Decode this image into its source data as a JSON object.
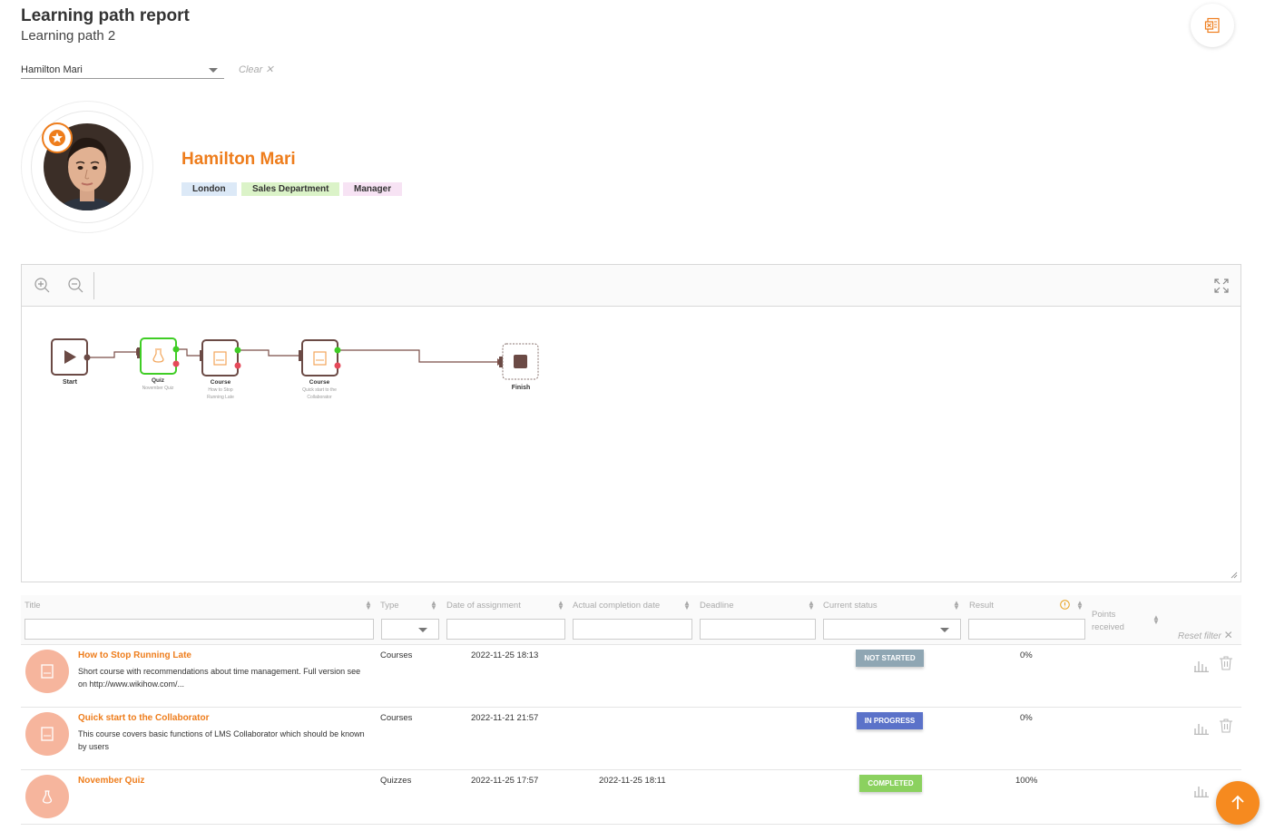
{
  "header": {
    "title": "Learning path report",
    "subtitle": "Learning path 2",
    "export_icon": "excel-export-icon"
  },
  "filter": {
    "user_value": "Hamilton Mari",
    "clear_label": "Clear"
  },
  "profile": {
    "name": "Hamilton Mari",
    "tags": [
      "London",
      "Sales Department",
      "Manager"
    ]
  },
  "diagram": {
    "nodes": [
      {
        "label": "Start",
        "sub": "",
        "sub2": ""
      },
      {
        "label": "Quiz",
        "sub": "November Quiz",
        "sub2": ""
      },
      {
        "label": "Course",
        "sub": "How to Stop",
        "sub2": "Running Late"
      },
      {
        "label": "Course",
        "sub": "Quick start to the",
        "sub2": "Collaborator"
      },
      {
        "label": "Finish",
        "sub": "",
        "sub2": ""
      }
    ]
  },
  "table": {
    "columns": {
      "title": "Title",
      "type": "Type",
      "assignment": "Date of assignment",
      "completion": "Actual completion date",
      "deadline": "Deadline",
      "status": "Current status",
      "result": "Result",
      "points_line1": "Points",
      "points_line2": "received"
    },
    "reset_filter": "Reset filter",
    "rows": [
      {
        "title": "How to Stop Running Late",
        "desc": "Short course with recommendations about time management. Full version see on http://www.wikihow.com/...",
        "type": "Courses",
        "assigned": "2022-11-25 18:13",
        "completed": "",
        "status": "NOT STARTED",
        "result": "0%"
      },
      {
        "title": "Quick start to the Collaborator",
        "desc": "This course covers basic functions of LMS Collaborator which should be known by users",
        "type": "Courses",
        "assigned": "2022-11-21 21:57",
        "completed": "",
        "status": "IN PROGRESS",
        "result": "0%"
      },
      {
        "title": "November Quiz",
        "desc": "",
        "type": "Quizzes",
        "assigned": "2022-11-25 17:57",
        "completed": "2022-11-25 18:11",
        "status": "COMPLETED",
        "result": "100%"
      }
    ]
  },
  "colors": {
    "accent": "#ee7d1c",
    "status_not_started": "#8fa6b3",
    "status_in_progress": "#5b72c9",
    "status_completed": "#8bd15f"
  }
}
